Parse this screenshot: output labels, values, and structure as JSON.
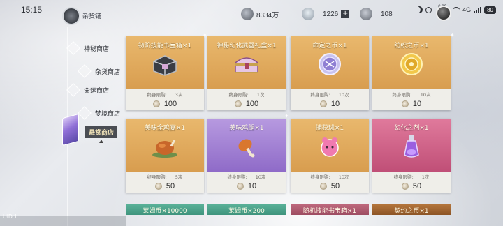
{
  "status": {
    "time": "15:15",
    "net_speed": "0.00 KB/s",
    "net_type": "4G",
    "battery": "80"
  },
  "shop": {
    "title": "杂货铺"
  },
  "currency": [
    {
      "value": "8334万",
      "icon": "coin-icon",
      "color": "#8a8f99"
    },
    {
      "value": "1226",
      "icon": "cat-face-icon",
      "color": "#9fa9b3",
      "has_plus": true
    },
    {
      "value": "108",
      "icon": "shell-icon",
      "color": "#8a8f99"
    }
  ],
  "nav": {
    "items": [
      {
        "label": "神秘商店"
      },
      {
        "label": "杂货商店"
      },
      {
        "label": "命运商店"
      },
      {
        "label": "梦境商店"
      },
      {
        "label": "悬赏商店",
        "active": true
      }
    ]
  },
  "items": [
    {
      "title": "初阶技能书宝箱×1",
      "limit_label": "终身限购:",
      "limit_value": "3次",
      "price": "100",
      "color": "gold",
      "icon": "dark-chest-icon"
    },
    {
      "title": "神秘幻化武器礼盒×1",
      "limit_label": "终身限购:",
      "limit_value": "1次",
      "price": "100",
      "color": "gold",
      "icon": "ornate-chest-icon"
    },
    {
      "title": "命定之币×1",
      "limit_label": "终身限购:",
      "limit_value": "10次",
      "price": "10",
      "color": "gold",
      "icon": "destiny-coin-icon"
    },
    {
      "title": "纺织之币×1",
      "limit_label": "终身限购:",
      "limit_value": "10次",
      "price": "10",
      "color": "gold",
      "icon": "weaving-coin-icon"
    },
    {
      "title": "美味全鸡宴×1",
      "limit_label": "终身限购:",
      "limit_value": "5次",
      "price": "50",
      "color": "gold",
      "icon": "roast-chicken-icon"
    },
    {
      "title": "美味鸡腿×1",
      "limit_label": "终身限购:",
      "limit_value": "10次",
      "price": "10",
      "color": "purple",
      "icon": "drumstick-icon"
    },
    {
      "title": "捕获球×1",
      "limit_label": "终身限购:",
      "limit_value": "10次",
      "price": "50",
      "color": "gold",
      "icon": "capture-ball-icon"
    },
    {
      "title": "幻化之剂×1",
      "limit_label": "终身限购:",
      "limit_value": "1次",
      "price": "50",
      "color": "pink",
      "icon": "potion-bottle-icon"
    }
  ],
  "next_row": [
    {
      "title": "莱姆币×10000",
      "color": "teal"
    },
    {
      "title": "莱姆币×200",
      "color": "teal"
    },
    {
      "title": "随机技能书宝箱×1",
      "color": "rose"
    },
    {
      "title": "契约之币×1",
      "color": "brown"
    }
  ],
  "uid": "UID:1"
}
